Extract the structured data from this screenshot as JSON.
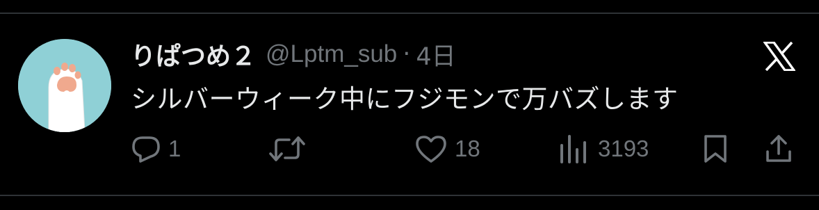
{
  "tweet": {
    "display_name": "りぱつめ２",
    "handle": "@Lptm_sub",
    "separator": "·",
    "time": "4日",
    "text": "シルバーウィーク中にフジモンで万バズします"
  },
  "actions": {
    "reply_count": "1",
    "retweet_count": "",
    "like_count": "18",
    "views_count": "3193"
  },
  "colors": {
    "background": "#000000",
    "primary_text": "#e7e9ea",
    "secondary_text": "#71767b",
    "divider": "#2f3336",
    "avatar_bg": "#8fd0d6"
  },
  "icons": {
    "logo": "x-logo-icon",
    "reply": "reply-icon",
    "retweet": "retweet-icon",
    "like": "heart-icon",
    "views": "views-bar-icon",
    "bookmark": "bookmark-icon",
    "share": "share-icon"
  }
}
